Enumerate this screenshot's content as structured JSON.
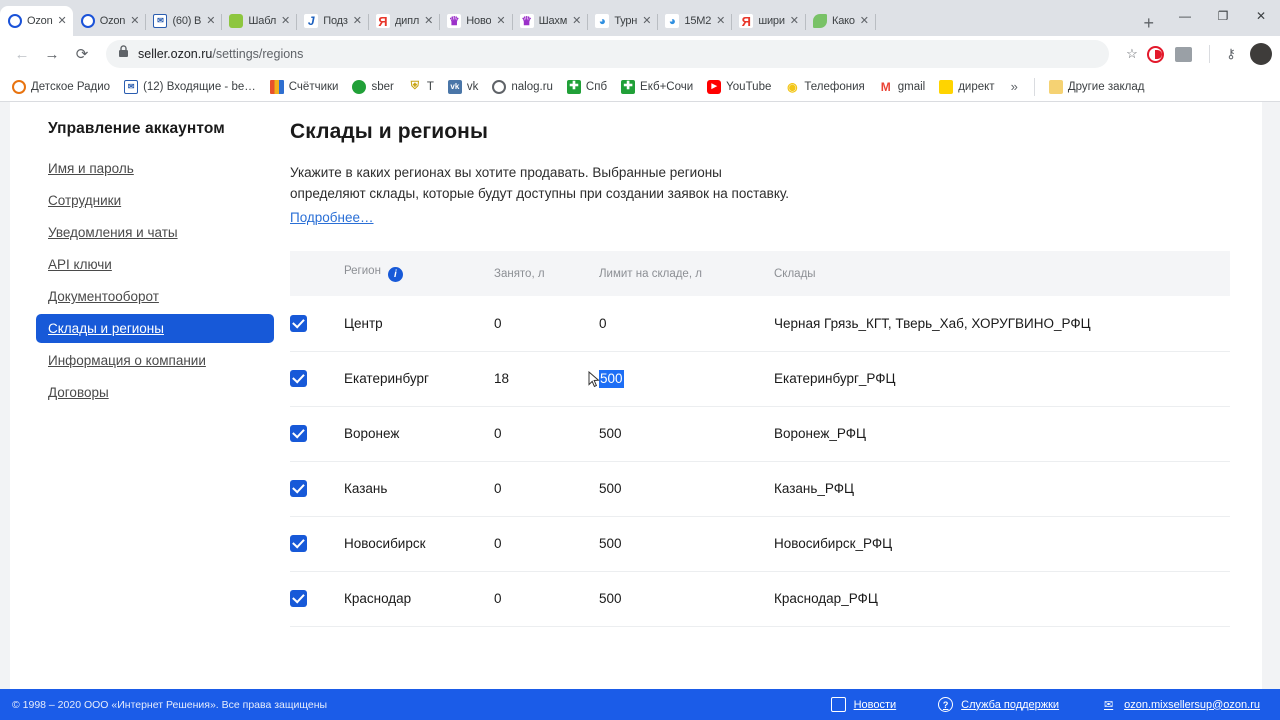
{
  "browser": {
    "tabs": [
      {
        "title": "Ozon",
        "favicon": "ozon-icon",
        "active": true
      },
      {
        "title": "Ozon",
        "favicon": "ozon-icon",
        "active": false
      },
      {
        "title": "(60) В",
        "favicon": "mail-icon",
        "active": false
      },
      {
        "title": "Шабл",
        "favicon": "green-doc-icon",
        "active": false
      },
      {
        "title": "Подз",
        "favicon": "blue-j-icon",
        "active": false
      },
      {
        "title": "дипл",
        "favicon": "yandex-icon",
        "active": false
      },
      {
        "title": "Ново",
        "favicon": "crown-icon",
        "active": false
      },
      {
        "title": "Шахм",
        "favicon": "crown-icon",
        "active": false
      },
      {
        "title": "Турн",
        "favicon": "cyan-swirl-icon",
        "active": false
      },
      {
        "title": "15M2",
        "favicon": "cyan-swirl-icon",
        "active": false
      },
      {
        "title": "шири",
        "favicon": "yandex-icon",
        "active": false
      },
      {
        "title": "Како",
        "favicon": "green-leaf-icon",
        "active": false
      }
    ],
    "new_tab_label": "+",
    "window_controls": {
      "minimize": "—",
      "maximize": "❐",
      "close": "✕"
    },
    "nav": {
      "back": "←",
      "forward": "→",
      "reload": "⟳"
    },
    "address": {
      "lock": "🔒",
      "host": "seller.ozon.ru",
      "path": "/settings/regions"
    },
    "toolbar_icons": [
      "star-icon",
      "opera-extension-icon",
      "image-extension-icon",
      "key-icon",
      "avatar"
    ],
    "bookmarks": [
      {
        "label": "Детское Радио",
        "icon": "orange-circle-icon"
      },
      {
        "label": "(12) Входящие - be…",
        "icon": "mail-icon"
      },
      {
        "label": "Счётчики",
        "icon": "bar-chart-icon"
      },
      {
        "label": "sber",
        "icon": "sber-icon"
      },
      {
        "label": "T",
        "icon": "shield-icon"
      },
      {
        "label": "vk",
        "icon": "vk-icon"
      },
      {
        "label": "nalog.ru",
        "icon": "nalog-icon"
      },
      {
        "label": "Спб",
        "icon": "green-cross-icon"
      },
      {
        "label": "Екб+Сочи",
        "icon": "green-cross-icon"
      },
      {
        "label": "YouTube",
        "icon": "youtube-icon"
      },
      {
        "label": "Телефония",
        "icon": "bulb-icon"
      },
      {
        "label": "gmail",
        "icon": "gmail-icon"
      },
      {
        "label": "директ",
        "icon": "direct-icon"
      }
    ],
    "bookmarks_overflow": "»",
    "other_bookmarks": {
      "label": "Другие заклад",
      "icon": "folder-icon"
    }
  },
  "sidebar": {
    "title": "Управление аккаунтом",
    "items": [
      {
        "label": "Имя и пароль",
        "active": false
      },
      {
        "label": "Сотрудники",
        "active": false
      },
      {
        "label": "Уведомления и чаты",
        "active": false
      },
      {
        "label": "API ключи",
        "active": false
      },
      {
        "label": "Документооборот",
        "active": false
      },
      {
        "label": "Склады и регионы",
        "active": true
      },
      {
        "label": "Информация о компании",
        "active": false
      },
      {
        "label": "Договоры",
        "active": false
      }
    ]
  },
  "main": {
    "title": "Склады и регионы",
    "description_line1": "Укажите в каких регионах вы хотите продавать. Выбранные регионы",
    "description_line2": "определяют склады, которые будут доступны при создании заявок на поставку.",
    "more_link": "Подробнее…",
    "table": {
      "headers": {
        "region": "Регион",
        "busy": "Занято, л",
        "limit": "Лимит на складе, л",
        "warehouses": "Склады"
      },
      "rows": [
        {
          "checked": true,
          "region": "Центр",
          "busy": "0",
          "limit": "0",
          "limit_selected": false,
          "warehouses": "Черная Грязь_КГТ, Тверь_Хаб, ХОРУГВИНО_РФЦ"
        },
        {
          "checked": true,
          "region": "Екатеринбург",
          "busy": "18",
          "limit": "500",
          "limit_selected": true,
          "warehouses": "Екатеринбург_РФЦ"
        },
        {
          "checked": true,
          "region": "Воронеж",
          "busy": "0",
          "limit": "500",
          "limit_selected": false,
          "warehouses": "Воронеж_РФЦ"
        },
        {
          "checked": true,
          "region": "Казань",
          "busy": "0",
          "limit": "500",
          "limit_selected": false,
          "warehouses": "Казань_РФЦ"
        },
        {
          "checked": true,
          "region": "Новосибирск",
          "busy": "0",
          "limit": "500",
          "limit_selected": false,
          "warehouses": "Новосибирск_РФЦ"
        },
        {
          "checked": true,
          "region": "Краснодар",
          "busy": "0",
          "limit": "500",
          "limit_selected": false,
          "warehouses": "Краснодар_РФЦ"
        }
      ]
    }
  },
  "footer": {
    "copyright": "© 1998 – 2020 ООО «Интернет Решения». Все права защищены",
    "links": [
      {
        "label": "Новости",
        "icon": "news-icon"
      },
      {
        "label": "Служба поддержки",
        "icon": "question-icon"
      },
      {
        "label": "ozon.mixsellersup@ozon.ru",
        "icon": "envelope-icon"
      }
    ]
  },
  "colors": {
    "accent": "#1759d8",
    "footer_bg": "#1b5ce8",
    "selection": "#1d6ef5"
  }
}
